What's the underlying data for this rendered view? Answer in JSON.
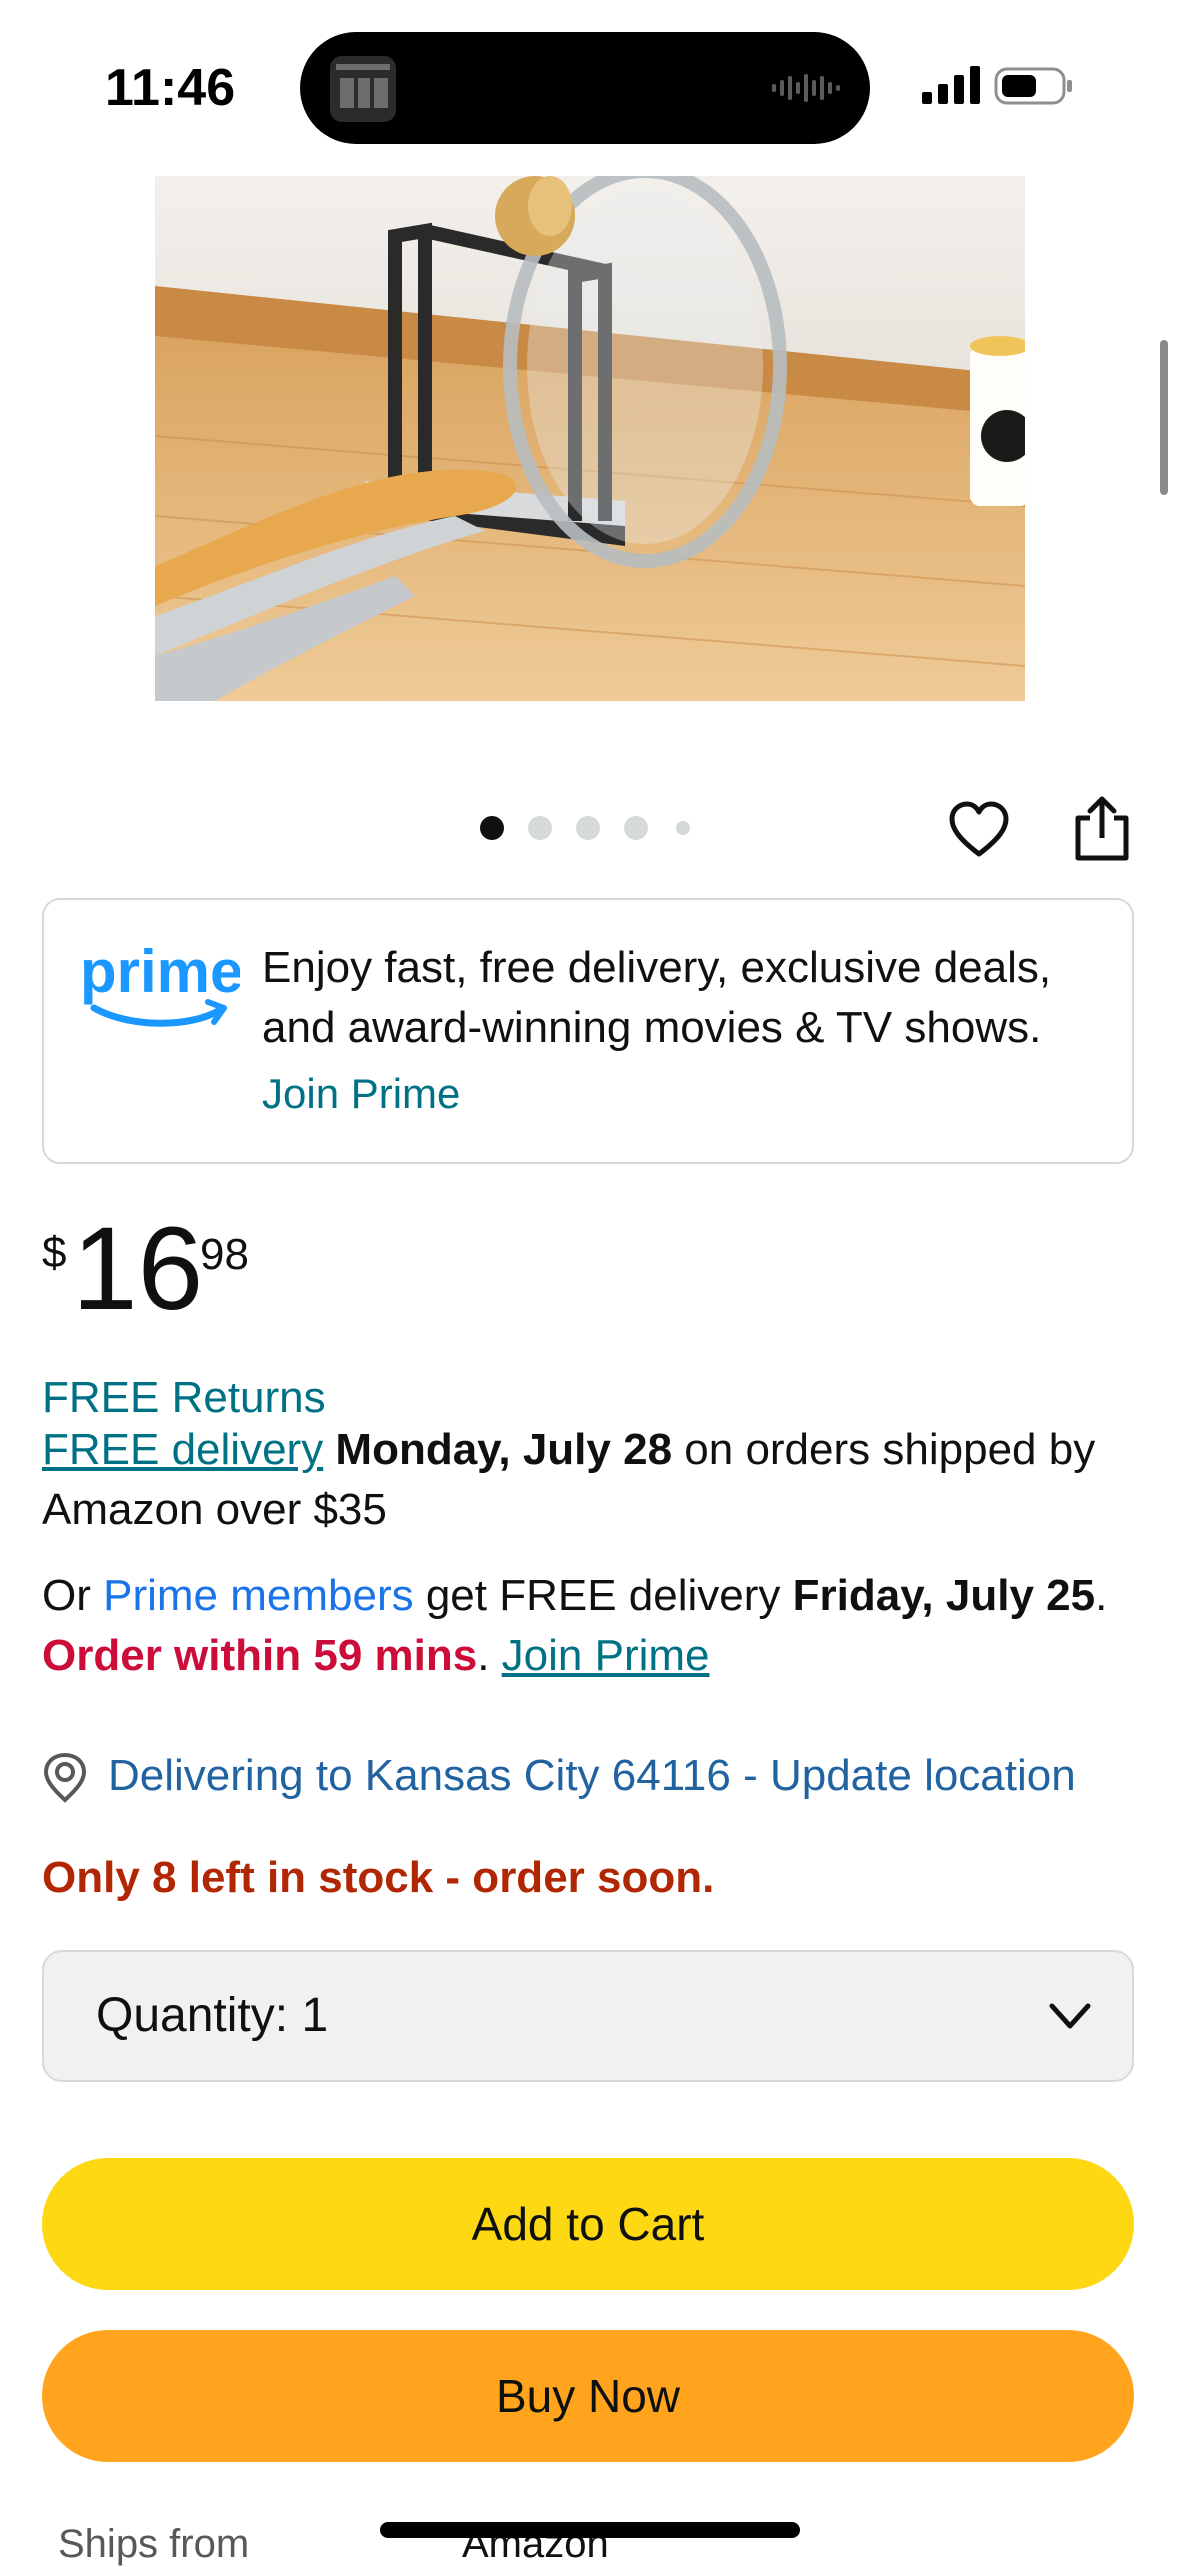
{
  "status_bar": {
    "time": "11:46"
  },
  "product": {
    "image_alt": "Black metal pot lid holder with clear glass lid and spatula on wooden counter",
    "image_count": 5,
    "active_image": 1
  },
  "prime_promo": {
    "text": "Enjoy fast, free delivery, exclusive deals, and award-winning movies & TV shows.",
    "join_label": "Join Prime"
  },
  "price": {
    "symbol": "$",
    "whole": "16",
    "fraction": "98"
  },
  "returns": "FREE Returns",
  "delivery": {
    "free_link": "FREE delivery",
    "date": "Monday, July 28",
    "rest": " on orders shipped by Amazon over $35"
  },
  "prime_delivery": {
    "prefix": "Or ",
    "members_link": "Prime members",
    "mid": " get FREE delivery ",
    "date": "Friday, July 25",
    "end": ".",
    "order_within": "Order within 59 mins",
    "sep": ". ",
    "join_link": "Join Prime"
  },
  "location": "Delivering to Kansas City 64116 - Update location",
  "stock": "Only 8 left in stock - order soon.",
  "quantity": {
    "label": "Quantity:",
    "value": "1"
  },
  "buttons": {
    "add_to_cart": "Add to Cart",
    "buy_now": "Buy Now"
  },
  "ships_from": {
    "label": "Ships from",
    "value": "Amazon"
  },
  "colors": {
    "cart": "#ffd814",
    "buy": "#ffa41c",
    "link": "#007185",
    "urgent": "#cc0c39",
    "stock": "#b12704"
  }
}
